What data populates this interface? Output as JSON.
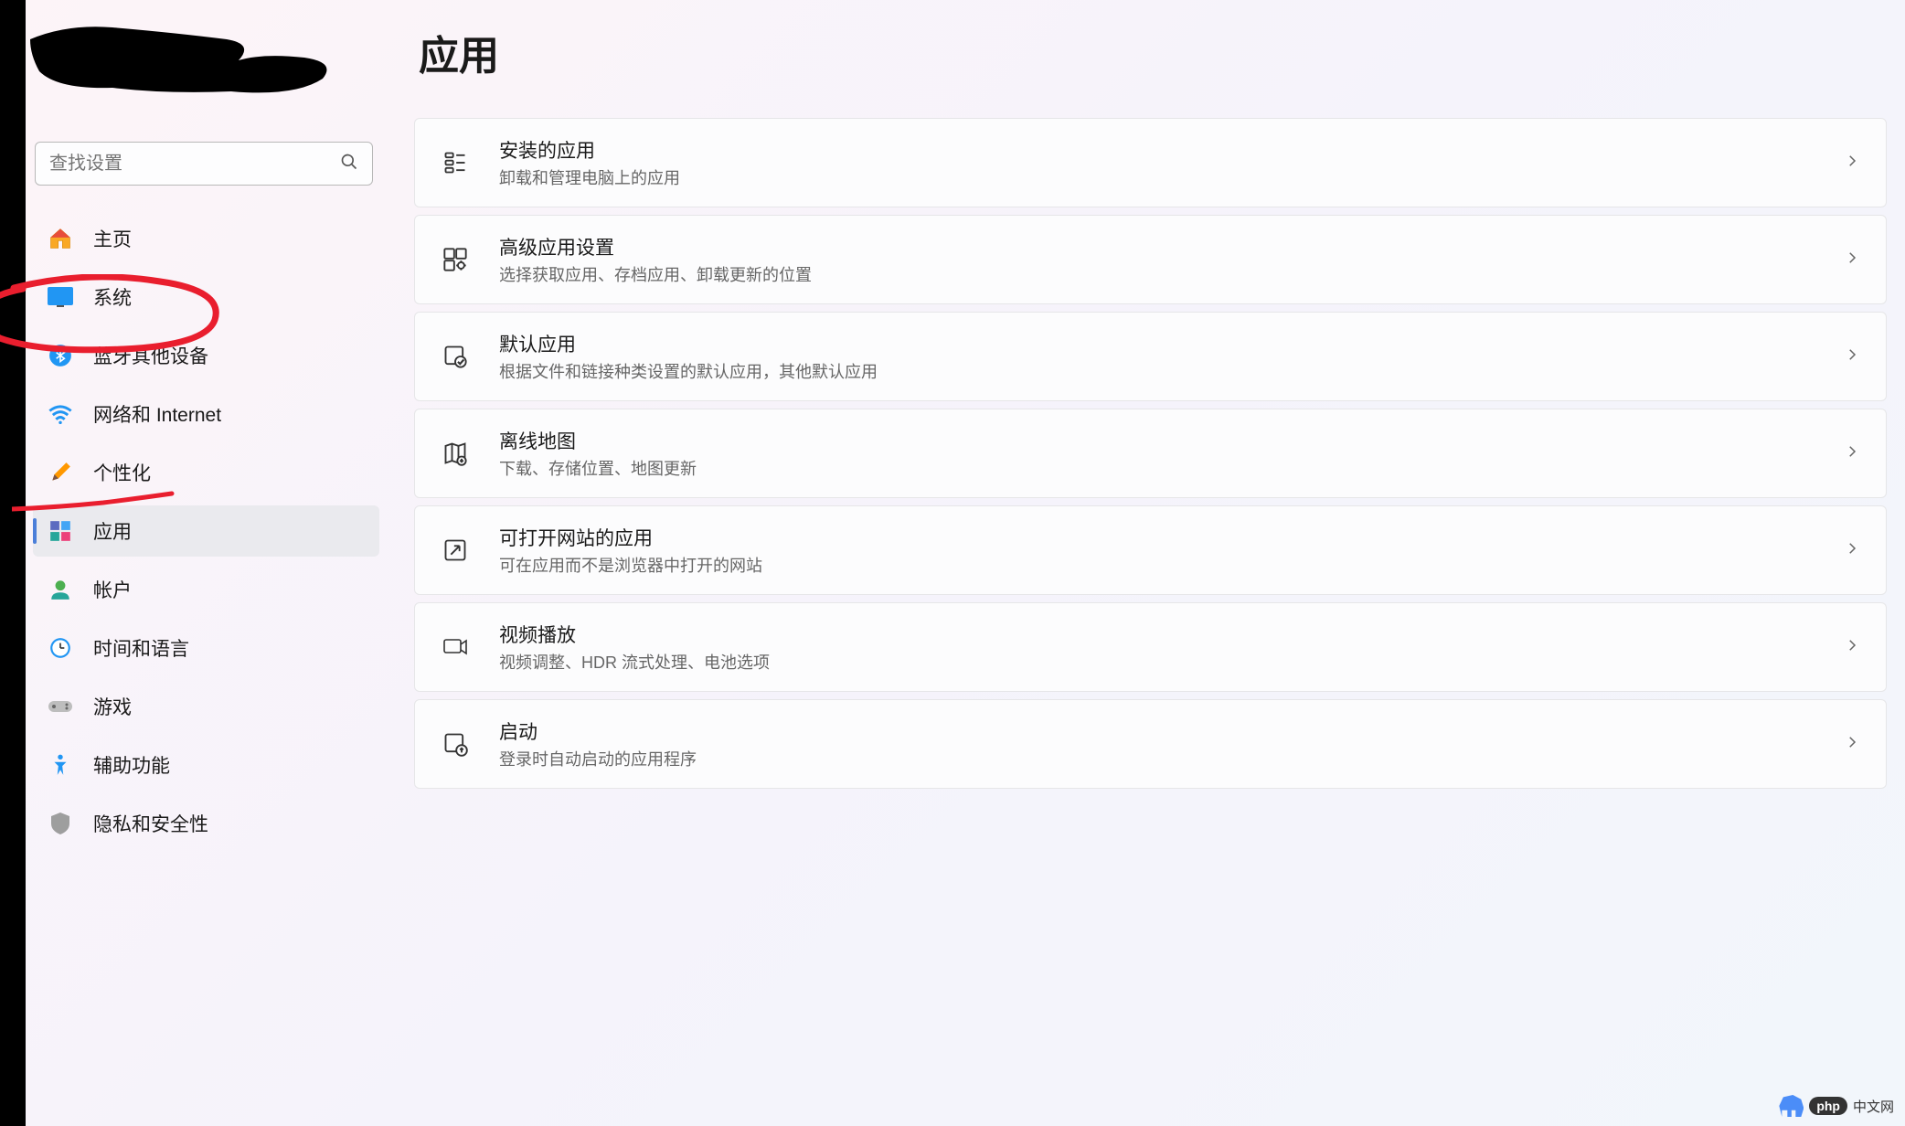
{
  "search": {
    "placeholder": "查找设置"
  },
  "sidebar": {
    "items": [
      {
        "label": "主页",
        "icon": "home"
      },
      {
        "label": "系统",
        "icon": "system"
      },
      {
        "label": "蓝牙其他设备",
        "icon": "bluetooth"
      },
      {
        "label": "网络和 Internet",
        "icon": "wifi"
      },
      {
        "label": "个性化",
        "icon": "personalize"
      },
      {
        "label": "应用",
        "icon": "apps"
      },
      {
        "label": "帐户",
        "icon": "account"
      },
      {
        "label": "时间和语言",
        "icon": "time"
      },
      {
        "label": "游戏",
        "icon": "gaming"
      },
      {
        "label": "辅助功能",
        "icon": "accessibility"
      },
      {
        "label": "隐私和安全性",
        "icon": "privacy"
      }
    ],
    "active_index": 5
  },
  "page": {
    "title": "应用"
  },
  "settings": [
    {
      "title": "安装的应用",
      "desc": "卸载和管理电脑上的应用",
      "icon": "installed"
    },
    {
      "title": "高级应用设置",
      "desc": "选择获取应用、存档应用、卸载更新的位置",
      "icon": "advanced"
    },
    {
      "title": "默认应用",
      "desc": "根据文件和链接种类设置的默认应用，其他默认应用",
      "icon": "default"
    },
    {
      "title": "离线地图",
      "desc": "下载、存储位置、地图更新",
      "icon": "maps"
    },
    {
      "title": "可打开网站的应用",
      "desc": "可在应用而不是浏览器中打开的网站",
      "icon": "websites"
    },
    {
      "title": "视频播放",
      "desc": "视频调整、HDR 流式处理、电池选项",
      "icon": "video"
    },
    {
      "title": "启动",
      "desc": "登录时自动启动的应用程序",
      "icon": "startup"
    }
  ],
  "watermark": {
    "brand": "php",
    "text": "中文网"
  }
}
